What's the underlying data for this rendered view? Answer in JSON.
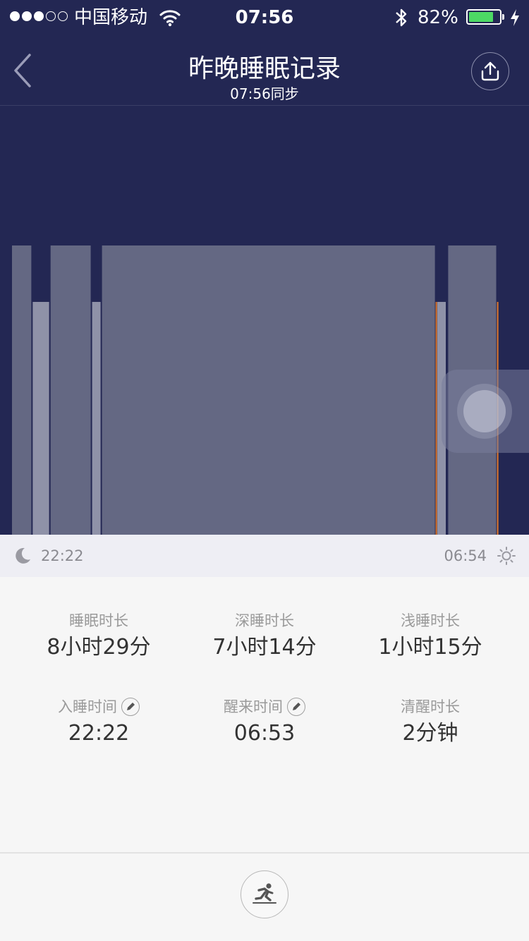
{
  "status_bar": {
    "signal_bars_filled": 3,
    "signal_bars_total": 5,
    "carrier": "中国移动",
    "time": "07:56",
    "battery_percent": "82%",
    "battery_level": 0.82,
    "battery_color": "#4cd964",
    "icons": [
      "wifi-icon",
      "bluetooth-icon",
      "battery-icon",
      "charging-icon"
    ]
  },
  "nav": {
    "title": "昨晚睡眠记录",
    "subtitle": "07:56同步",
    "back_icon": "chevron-left-icon",
    "share_icon": "upload-icon"
  },
  "chart_data": {
    "type": "bar",
    "x_start": "22:22",
    "x_end": "06:54",
    "levels": [
      "深睡",
      "浅睡"
    ],
    "segments": [
      {
        "start": "22:22",
        "end": "22:43",
        "stage": "深睡"
      },
      {
        "start": "22:43",
        "end": "23:01",
        "stage": "浅睡"
      },
      {
        "start": "23:01",
        "end": "23:43",
        "stage": "深睡"
      },
      {
        "start": "23:43",
        "end": "23:53",
        "stage": "浅睡"
      },
      {
        "start": "23:53",
        "end": "05:31",
        "stage": "深睡"
      },
      {
        "start": "05:31",
        "end": "05:32",
        "stage": "清醒"
      },
      {
        "start": "05:32",
        "end": "05:42",
        "stage": "浅睡"
      },
      {
        "start": "05:43",
        "end": "06:33",
        "stage": "深睡"
      },
      {
        "start": "06:33",
        "end": "06:34",
        "stage": "清醒"
      }
    ],
    "colors": {
      "深睡": "#646883",
      "浅睡": "#8f92a8",
      "清醒": "#e07a2e",
      "background": "#232753"
    }
  },
  "time_axis": {
    "start": "22:22",
    "end": "06:54",
    "start_icon": "moon-icon",
    "end_icon": "sun-icon"
  },
  "stats": [
    {
      "label": "睡眠时长",
      "value": "8小时29分",
      "editable": false
    },
    {
      "label": "深睡时长",
      "value": "7小时14分",
      "editable": false
    },
    {
      "label": "浅睡时长",
      "value": "1小时15分",
      "editable": false
    },
    {
      "label": "入睡时间",
      "value": "22:22",
      "editable": true
    },
    {
      "label": "醒来时间",
      "value": "06:53",
      "editable": true
    },
    {
      "label": "清醒时长",
      "value": "2分钟",
      "editable": false
    }
  ],
  "bottom": {
    "action_icon": "running-icon"
  }
}
